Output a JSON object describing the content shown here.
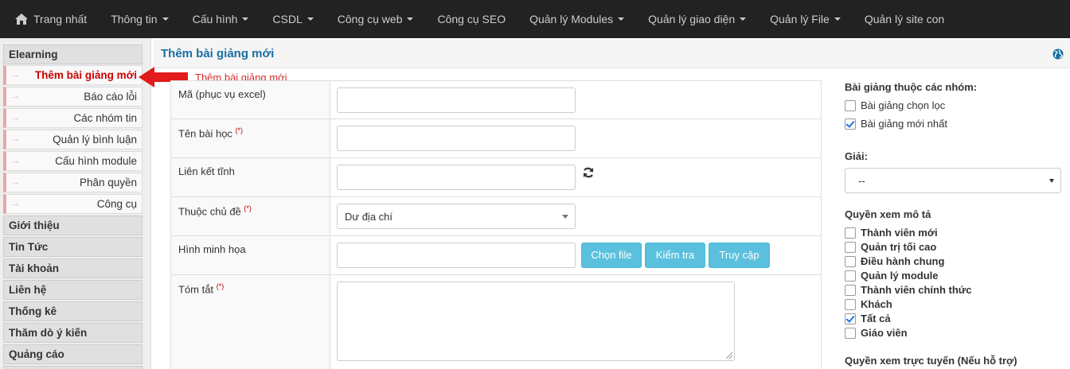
{
  "navbar": {
    "items": [
      {
        "label": "Trang nhất",
        "icon": "home-icon",
        "caret": false
      },
      {
        "label": "Thông tin",
        "caret": true
      },
      {
        "label": "Cấu hình",
        "caret": true
      },
      {
        "label": "CSDL",
        "caret": true
      },
      {
        "label": "Công cụ web",
        "caret": true
      },
      {
        "label": "Công cụ SEO",
        "caret": false
      },
      {
        "label": "Quản lý Modules",
        "caret": true
      },
      {
        "label": "Quản lý giao diện",
        "caret": true
      },
      {
        "label": "Quản lý File",
        "caret": true
      },
      {
        "label": "Quản lý site con",
        "caret": false
      }
    ]
  },
  "sidebar": {
    "section": "Elearning",
    "subitems": [
      "Thêm bài giảng mới",
      "Báo cáo lỗi",
      "Các nhóm tin",
      "Quản lý bình luận",
      "Cấu hình module",
      "Phân quyền",
      "Công cụ"
    ],
    "active_index": 0,
    "groups": [
      "Giới thiệu",
      "Tin Tức",
      "Tài khoản",
      "Liên hệ",
      "Thống kê",
      "Thăm dò ý kiến",
      "Quảng cáo"
    ]
  },
  "main": {
    "title": "Thêm bài giảng mới",
    "annotation": "Thêm bài giảng mới"
  },
  "form": {
    "code_label": "Mã (phục vụ excel)",
    "name_label": "Tên bài học",
    "alias_label": "Liên kết tĩnh",
    "topic_label": "Thuộc chủ đề",
    "topic_value": "Dư địa chí",
    "image_label": "Hình minh họa",
    "summary_label": "Tóm tắt",
    "required_mark": "(*)",
    "btn_choose": "Chọn file",
    "btn_check": "Kiểm tra",
    "btn_access": "Truy cập"
  },
  "right": {
    "groups_label": "Bài giảng thuộc các nhóm:",
    "groups": [
      {
        "label": "Bài giảng chọn lọc",
        "checked": false
      },
      {
        "label": "Bài giảng mới nhất",
        "checked": true
      }
    ],
    "award_label": "Giải:",
    "award_value": "--",
    "view_desc_label": "Quyền xem mô tả",
    "view_desc": [
      {
        "label": "Thành viên mới",
        "checked": false
      },
      {
        "label": "Quản trị tối cao",
        "checked": false
      },
      {
        "label": "Điều hành chung",
        "checked": false
      },
      {
        "label": "Quản lý module",
        "checked": false
      },
      {
        "label": "Thành viên chính thức",
        "checked": false
      },
      {
        "label": "Khách",
        "checked": false
      },
      {
        "label": "Tất cả",
        "checked": true
      },
      {
        "label": "Giáo viên",
        "checked": false
      }
    ],
    "view_online_label": "Quyền xem trực tuyến (Nếu hỗ trợ)"
  },
  "colors": {
    "navbar": "#222222",
    "accent_blue": "#1a6fa0",
    "active_red": "#cc0000",
    "button_info": "#5bc0de",
    "annotation_red": "#d32f2f"
  }
}
